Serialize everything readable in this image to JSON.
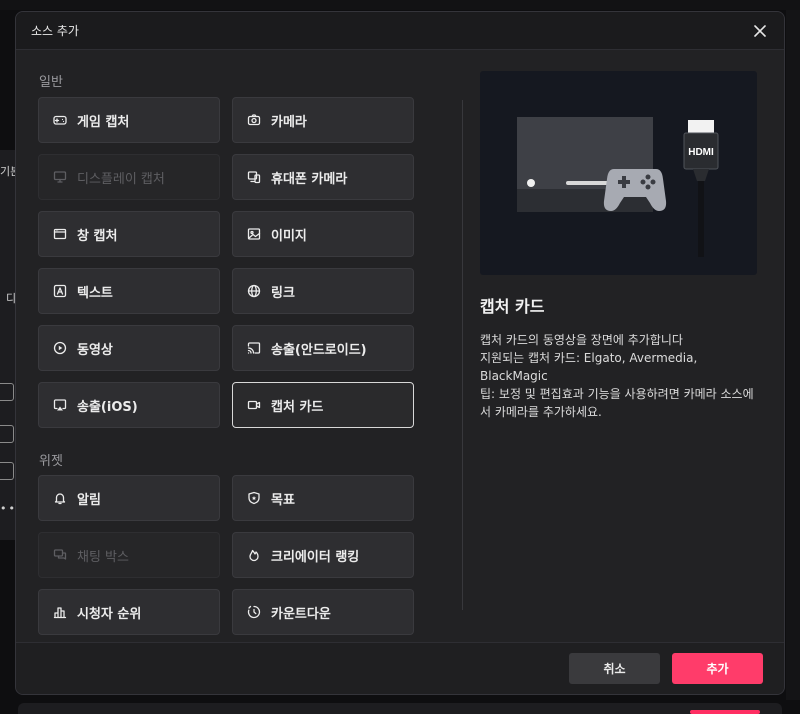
{
  "background": {
    "left_labels": [
      "기본",
      "디"
    ]
  },
  "modal": {
    "title": "소스 추가",
    "sections": [
      {
        "label": "일반",
        "items": [
          {
            "label": "게임 캡처",
            "icon": "gamepad-icon",
            "state": "normal"
          },
          {
            "label": "카메라",
            "icon": "camera-icon",
            "state": "normal"
          },
          {
            "label": "디스플레이 캡처",
            "icon": "monitor-icon",
            "state": "disabled"
          },
          {
            "label": "휴대폰 카메라",
            "icon": "phone-camera-icon",
            "state": "normal"
          },
          {
            "label": "창 캡처",
            "icon": "window-icon",
            "state": "normal"
          },
          {
            "label": "이미지",
            "icon": "image-icon",
            "state": "normal"
          },
          {
            "label": "텍스트",
            "icon": "text-icon",
            "state": "normal"
          },
          {
            "label": "링크",
            "icon": "globe-icon",
            "state": "normal"
          },
          {
            "label": "동영상",
            "icon": "play-icon",
            "state": "normal"
          },
          {
            "label": "송출(안드로이드)",
            "icon": "cast-icon",
            "state": "normal"
          },
          {
            "label": "송출(iOS)",
            "icon": "airplay-icon",
            "state": "normal"
          },
          {
            "label": "캡처 카드",
            "icon": "video-camera-icon",
            "state": "selected"
          }
        ]
      },
      {
        "label": "위젯",
        "items": [
          {
            "label": "알림",
            "icon": "bell-icon",
            "state": "normal"
          },
          {
            "label": "목표",
            "icon": "shield-icon",
            "state": "normal"
          },
          {
            "label": "채팅 박스",
            "icon": "chat-icon",
            "state": "disabled"
          },
          {
            "label": "크리에이터 랭킹",
            "icon": "flame-icon",
            "state": "normal"
          },
          {
            "label": "시청자 순위",
            "icon": "ranking-icon",
            "state": "normal"
          },
          {
            "label": "카운트다운",
            "icon": "timer-icon",
            "state": "normal"
          }
        ]
      }
    ],
    "detail": {
      "title": "캡처 카드",
      "description": [
        "캡처 카드의 동영상을 장면에 추가합니다",
        "지원되는 캡처 카드: Elgato, Avermedia, BlackMagic",
        "팁: 보정 및 편집효과 기능을 사용하려면 카메라 소스에서 카메라를 추가하세요."
      ],
      "preview_hdmi_label": "HDMI"
    },
    "footer": {
      "cancel_label": "취소",
      "add_label": "추가"
    },
    "colors": {
      "accent": "#ff3c6a",
      "selected_border": "#d8d8d8"
    }
  }
}
